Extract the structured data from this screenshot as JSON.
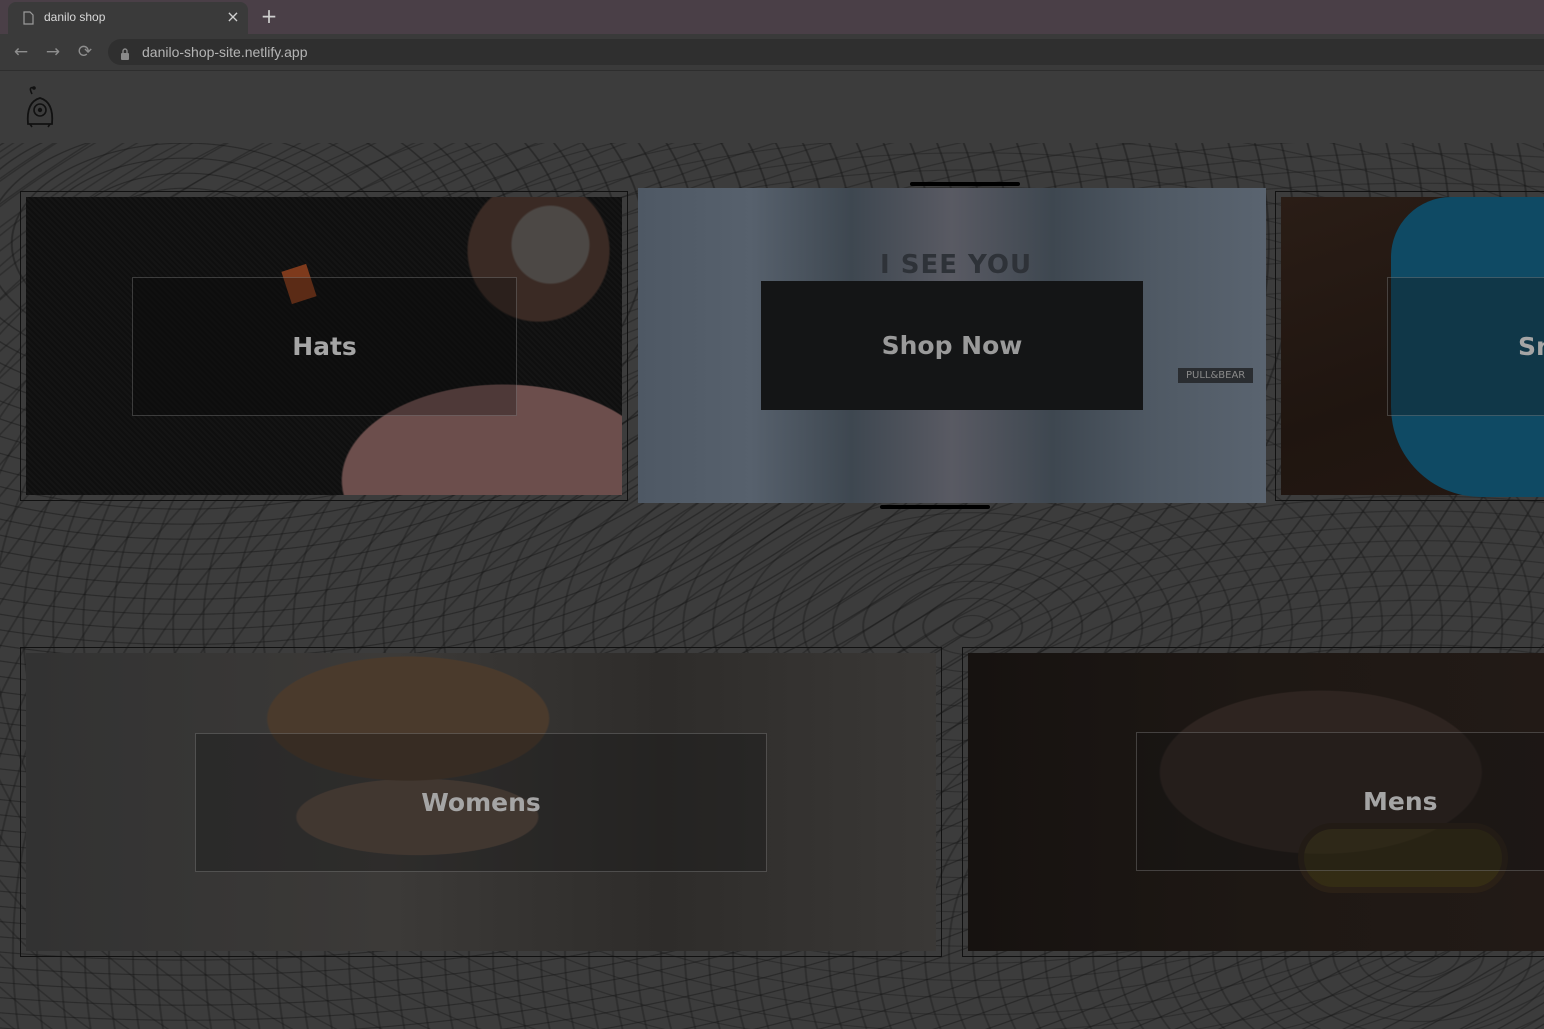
{
  "browser": {
    "tab_title": "danilo shop",
    "tab_close": "×",
    "new_tab": "+",
    "url": "danilo-shop-site.netlify.app",
    "nav": {
      "back": "←",
      "forward": "→",
      "reload": "⟳"
    }
  },
  "header": {
    "logo_icon": "alien-logo-icon"
  },
  "categories": [
    {
      "title": "Hats"
    },
    {
      "title": "Shop Now"
    },
    {
      "title": "Sneakers",
      "visible_text": "Sn"
    },
    {
      "title": "Womens"
    },
    {
      "title": "Mens"
    }
  ],
  "decor": {
    "jacket_text": "I SEE YOU",
    "brand_label": "PULL&BEAR"
  },
  "colors": {
    "overlay": "#3c3c3c",
    "label_text": "#a5a5a5"
  }
}
